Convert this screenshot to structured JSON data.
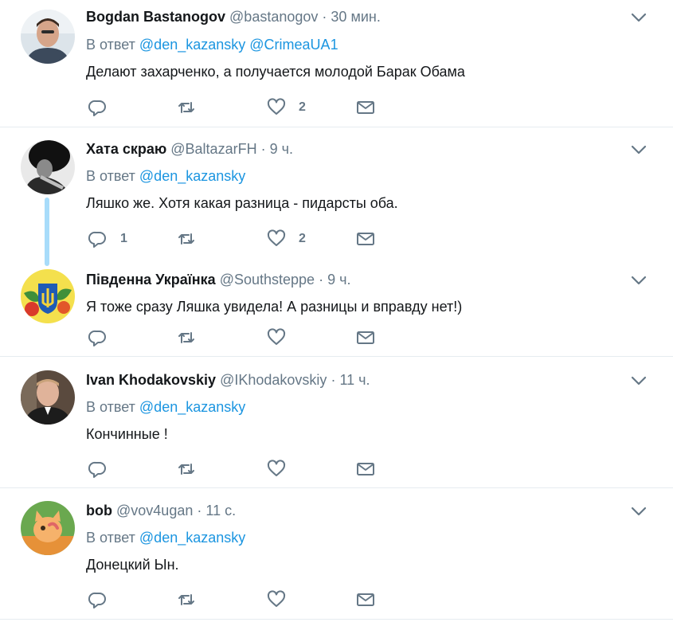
{
  "reply_prefix": "В ответ",
  "tweets": [
    {
      "name": "Bogdan Bastanogov",
      "handle": "@bastanogov",
      "dot": "·",
      "time": "30 мин.",
      "reply_to": [
        "@den_kazansky",
        "@CrimeaUA1"
      ],
      "text": "Делают захарченко, а получается молодой Барак Обама",
      "replies": "",
      "retweets": "",
      "likes": "2"
    },
    {
      "name": "Хата скраю",
      "handle": "@BaltazarFH",
      "dot": "·",
      "time": "9 ч.",
      "reply_to": [
        "@den_kazansky"
      ],
      "text": "Ляшко же. Хотя какая разница - пидарсты оба.",
      "replies": "1",
      "retweets": "",
      "likes": "2"
    },
    {
      "name": "Південна Українка",
      "handle": "@Southsteppe",
      "dot": "·",
      "time": "9 ч.",
      "reply_to": [],
      "text": "Я тоже сразу Ляшка увидела! А разницы и вправду нет!)",
      "replies": "",
      "retweets": "",
      "likes": ""
    },
    {
      "name": "Ivan Khodakovskiy",
      "handle": "@IKhodakovskiy",
      "dot": "·",
      "time": "11 ч.",
      "reply_to": [
        "@den_kazansky"
      ],
      "text": "Кончинные !",
      "replies": "",
      "retweets": "",
      "likes": ""
    },
    {
      "name": "bob",
      "handle": "@vov4ugan",
      "dot": "·",
      "time": "11 с.",
      "reply_to": [
        "@den_kazansky"
      ],
      "text": "Донецкий Ын.",
      "replies": "",
      "retweets": "",
      "likes": ""
    }
  ],
  "icons": {
    "reply": "reply-icon",
    "retweet": "retweet-icon",
    "like": "heart-icon",
    "dm": "envelope-icon",
    "caret": "chevron-down-icon"
  },
  "colors": {
    "text": "#14171a",
    "secondary": "#657786",
    "link": "#1b95e0",
    "thread_line": "#a8dcfa",
    "divider": "#e6ecf0"
  }
}
